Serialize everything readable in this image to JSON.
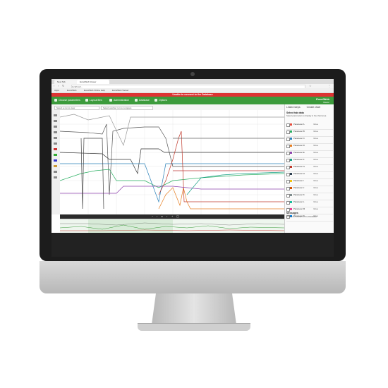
{
  "browser": {
    "tabs": [
      "New Tab",
      "ExcelWeb Viewer"
    ],
    "url": "localhost/...",
    "bookmarks": [
      "Apps",
      "ExcelWeb",
      "ExcelWeb Online Help",
      "ExcelWeb Viewer"
    ]
  },
  "alert": "Unable to connect to the Database",
  "toolbar": {
    "items": [
      "Choose parameters",
      "Layout files",
      "Administration",
      "Database",
      "Options"
    ],
    "brand": "ExcelWeb",
    "brand_sub": "Viewer"
  },
  "subbar": {
    "select_left": "Select a run to view",
    "select_right": "Select another run to compare"
  },
  "panel": {
    "buttons": [
      "Linked steps",
      "Create chart"
    ],
    "heading": "Select tab data",
    "note": "Select parameters to display in the chart area",
    "rows": [
      {
        "name": "Parameter A",
        "value": "Value",
        "color": "#e74c3c"
      },
      {
        "name": "Parameter B",
        "value": "Value",
        "color": "#27ae60"
      },
      {
        "name": "Parameter C",
        "value": "Value",
        "color": "#2980b9"
      },
      {
        "name": "Parameter D",
        "value": "Value",
        "color": "#e67e22"
      },
      {
        "name": "Parameter E",
        "value": "Value",
        "color": "#8e44ad"
      },
      {
        "name": "Parameter F",
        "value": "Value",
        "color": "#16a085"
      },
      {
        "name": "Parameter G",
        "value": "Value",
        "color": "#c0392b"
      },
      {
        "name": "Parameter H",
        "value": "Value",
        "color": "#2c3e50"
      },
      {
        "name": "Parameter I",
        "value": "Value",
        "color": "#f1c40f"
      },
      {
        "name": "Parameter J",
        "value": "Value",
        "color": "#d35400"
      },
      {
        "name": "Parameter K",
        "value": "Value",
        "color": "#7f8c8d"
      },
      {
        "name": "Parameter L",
        "value": "Value",
        "color": "#1abc9c"
      },
      {
        "name": "Parameter M",
        "value": "Value",
        "color": "#e84393"
      },
      {
        "name": "Parameter N",
        "value": "Value",
        "color": "#0984e3"
      }
    ],
    "messages_title": "Messages",
    "messages_text": "Unable to connect to the Database"
  },
  "colors": {
    "accent": "#3c9b3c",
    "alert": "#d33333"
  }
}
